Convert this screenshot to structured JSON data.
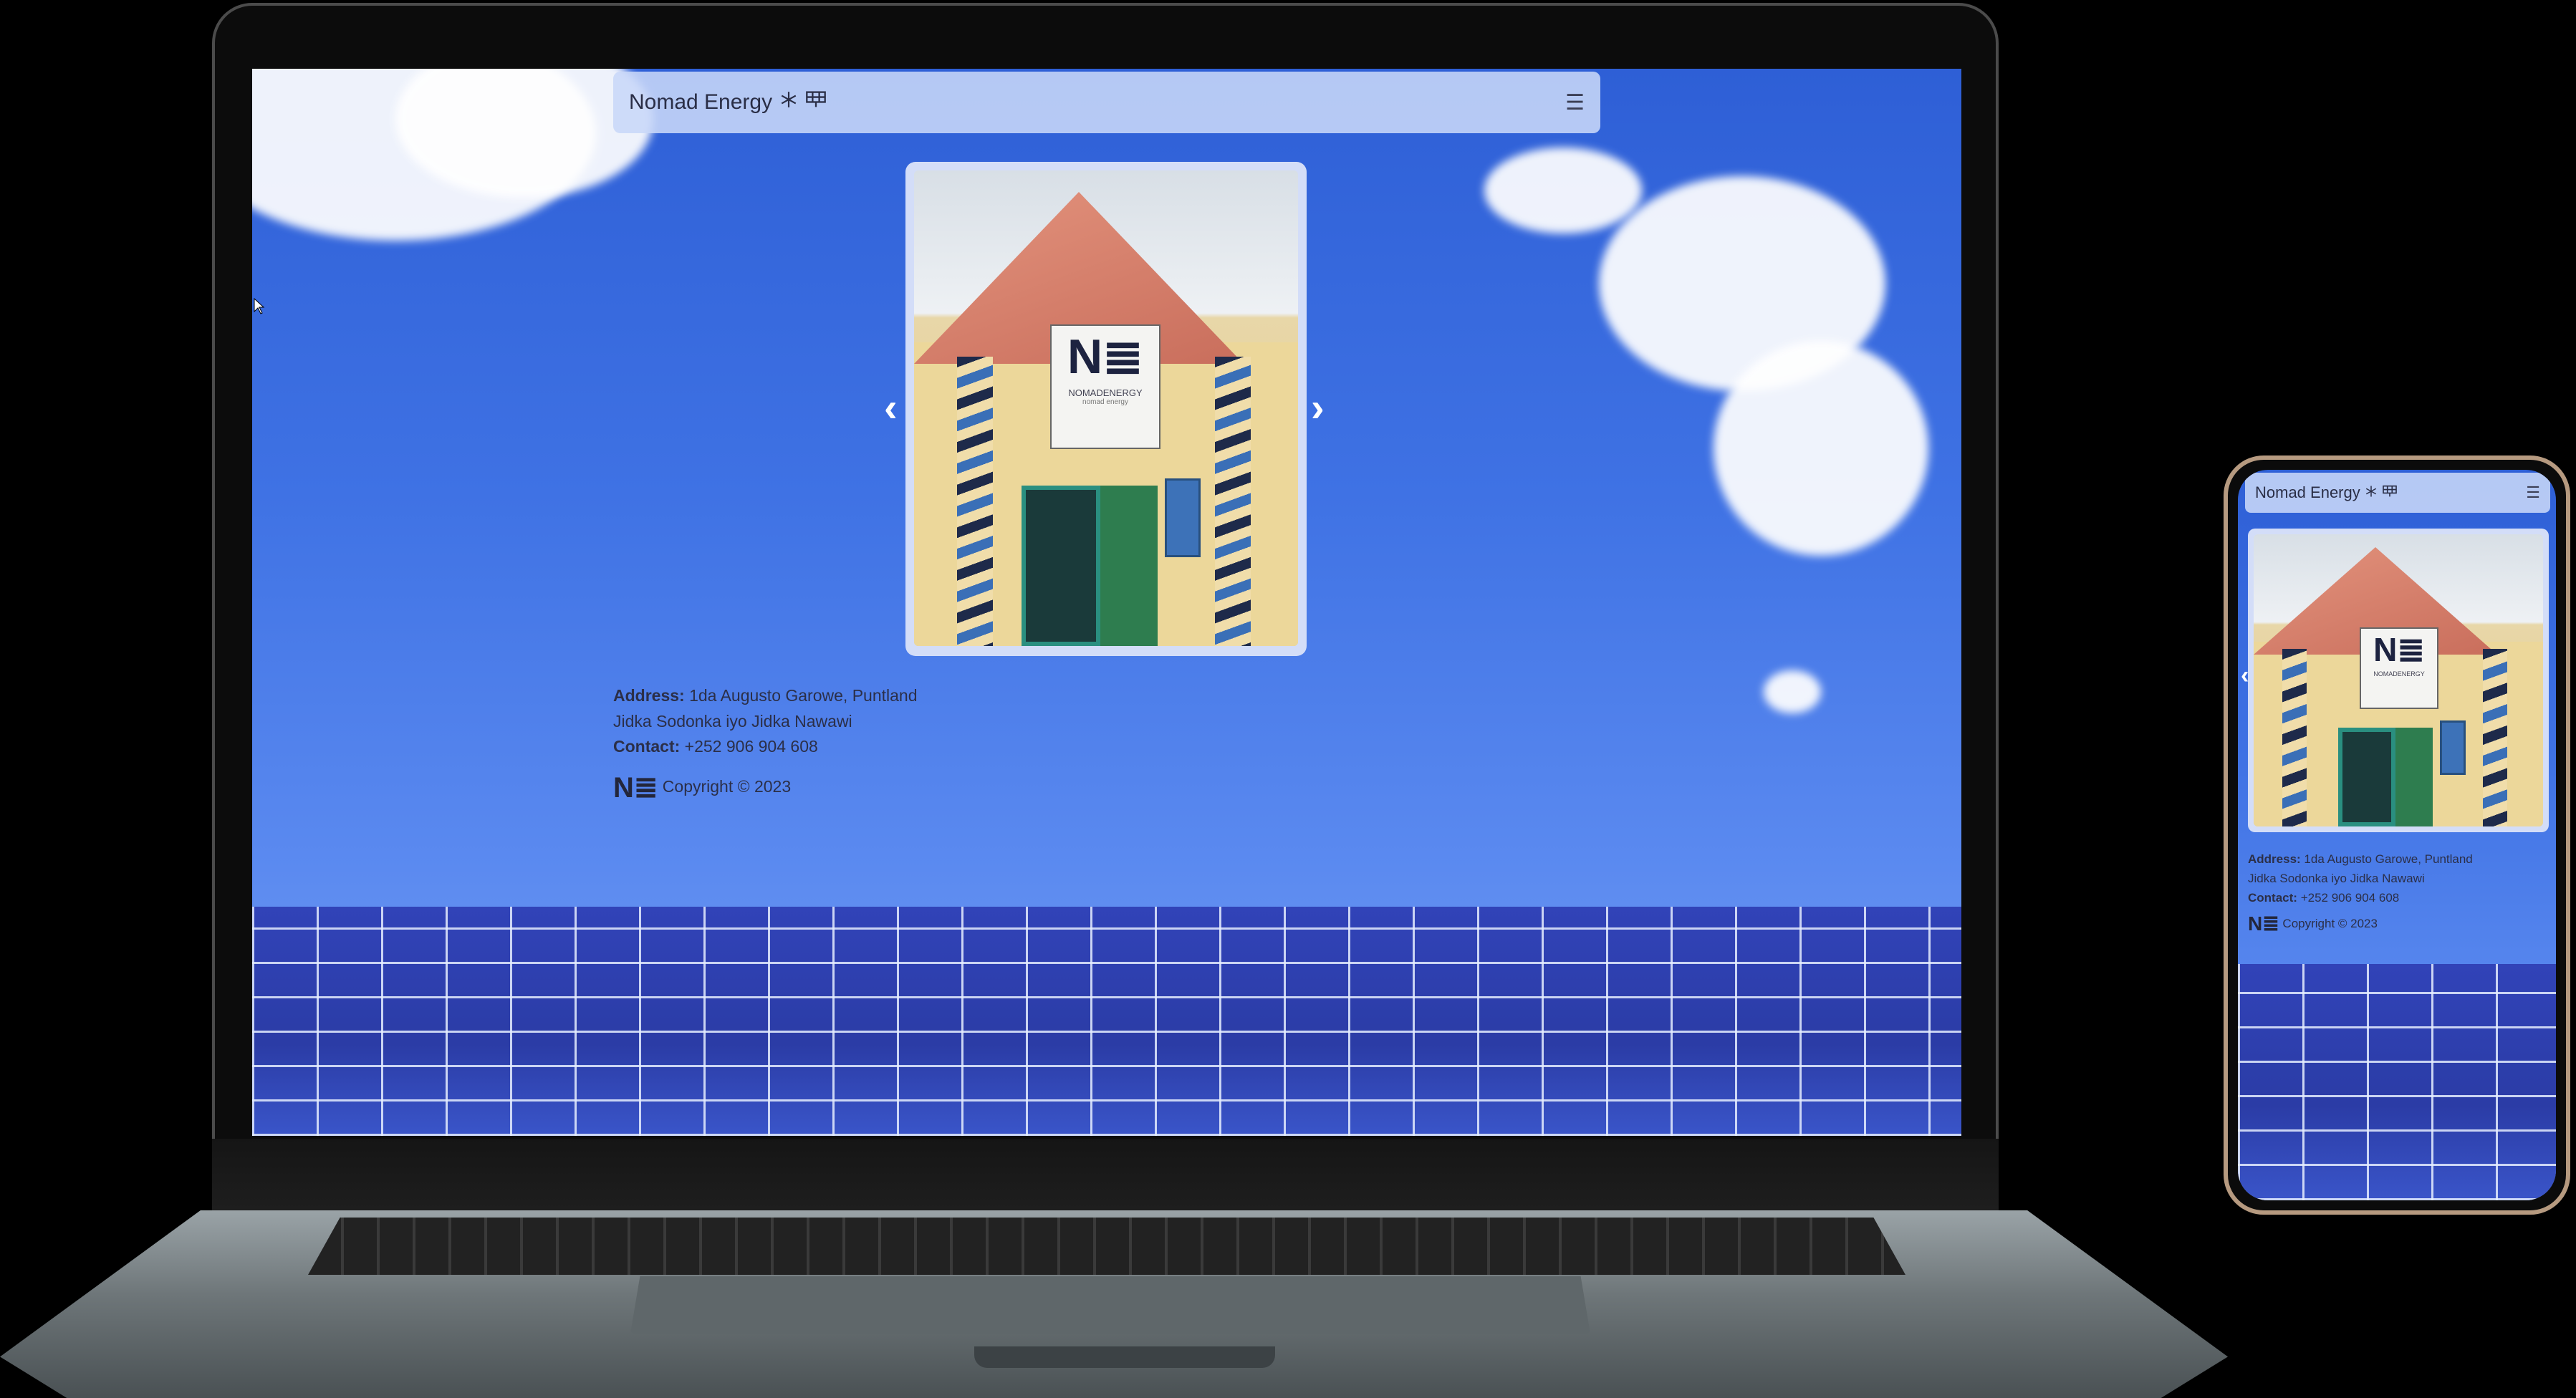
{
  "site": {
    "brand_name": "Nomad Energy",
    "brand_icons": [
      "snowflake-icon",
      "solar-panel-icon"
    ],
    "menu_icon": "hamburger-icon",
    "carousel": {
      "prev_label": "‹",
      "next_label": "›",
      "sign_logo": "N≣",
      "sign_name": "NOMADENERGY",
      "sign_tagline": "nomad energy"
    },
    "footer": {
      "address_label": "Address:",
      "address_value": "1da Augusto Garowe, Puntland",
      "address_line2": "Jidka Sodonka iyo Jidka Nawawi",
      "contact_label": "Contact:",
      "contact_value": "+252 906 904 608",
      "logo_text": "N≣",
      "copyright": "Copyright © 2023"
    }
  },
  "colors": {
    "sky": "#3f72e4",
    "navbar": "#c8d7f8",
    "text_dark": "#2a2e46",
    "phone_frame": "#b69a80"
  }
}
